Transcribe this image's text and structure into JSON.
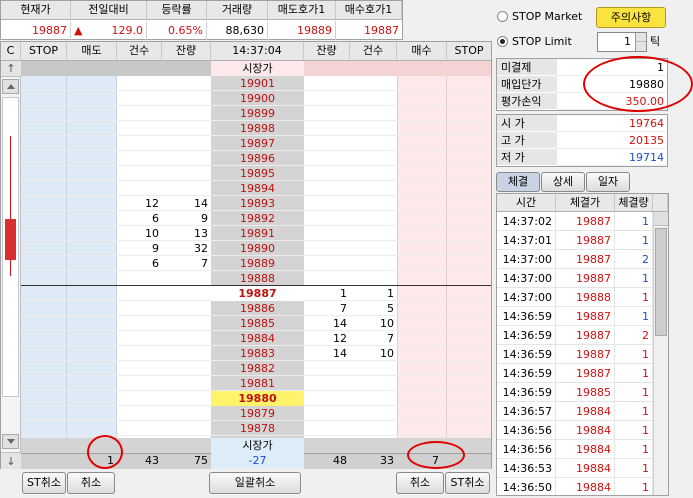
{
  "top_quote": {
    "headers": [
      "현재가",
      "전일대비",
      "등락률",
      "거래량",
      "매도호가1",
      "매수호가1"
    ],
    "current_price": "19887",
    "change_arrow": "▲",
    "change": "129.0",
    "change_rate": "0.65%",
    "volume": "88,630",
    "ask1": "19889",
    "bid1": "19887"
  },
  "orderbook_header": {
    "c": "C",
    "stop_left": "STOP",
    "sell": "매도",
    "sell_count": "건수",
    "sell_remain": "잔량",
    "time": "14:37:04",
    "buy_remain": "잔량",
    "buy_count": "건수",
    "buy": "매수",
    "stop_right": "STOP"
  },
  "market_price_label": "시장가",
  "price_rows": [
    {
      "price": "19901",
      "sell_count": "",
      "sell_remain": "",
      "buy_remain": "",
      "buy_count": ""
    },
    {
      "price": "19900",
      "sell_count": "",
      "sell_remain": "",
      "buy_remain": "",
      "buy_count": ""
    },
    {
      "price": "19899",
      "sell_count": "",
      "sell_remain": "",
      "buy_remain": "",
      "buy_count": ""
    },
    {
      "price": "19898",
      "sell_count": "",
      "sell_remain": "",
      "buy_remain": "",
      "buy_count": ""
    },
    {
      "price": "19897",
      "sell_count": "",
      "sell_remain": "",
      "buy_remain": "",
      "buy_count": ""
    },
    {
      "price": "19896",
      "sell_count": "",
      "sell_remain": "",
      "buy_remain": "",
      "buy_count": ""
    },
    {
      "price": "19895",
      "sell_count": "",
      "sell_remain": "",
      "buy_remain": "",
      "buy_count": ""
    },
    {
      "price": "19894",
      "sell_count": "",
      "sell_remain": "",
      "buy_remain": "",
      "buy_count": ""
    },
    {
      "price": "19893",
      "sell_count": "12",
      "sell_remain": "14",
      "buy_remain": "",
      "buy_count": ""
    },
    {
      "price": "19892",
      "sell_count": "6",
      "sell_remain": "9",
      "buy_remain": "",
      "buy_count": ""
    },
    {
      "price": "19891",
      "sell_count": "10",
      "sell_remain": "13",
      "buy_remain": "",
      "buy_count": ""
    },
    {
      "price": "19890",
      "sell_count": "9",
      "sell_remain": "32",
      "buy_remain": "",
      "buy_count": ""
    },
    {
      "price": "19889",
      "sell_count": "6",
      "sell_remain": "7",
      "buy_remain": "",
      "buy_count": ""
    },
    {
      "price": "19888",
      "sell_count": "",
      "sell_remain": "",
      "buy_remain": "",
      "buy_count": ""
    },
    {
      "price": "19887",
      "sell_count": "",
      "sell_remain": "",
      "buy_remain": "1",
      "buy_count": "1"
    },
    {
      "price": "19886",
      "sell_count": "",
      "sell_remain": "",
      "buy_remain": "7",
      "buy_count": "5"
    },
    {
      "price": "19885",
      "sell_count": "",
      "sell_remain": "",
      "buy_remain": "14",
      "buy_count": "10"
    },
    {
      "price": "19884",
      "sell_count": "",
      "sell_remain": "",
      "buy_remain": "12",
      "buy_count": "7"
    },
    {
      "price": "19883",
      "sell_count": "",
      "sell_remain": "",
      "buy_remain": "14",
      "buy_count": "10"
    },
    {
      "price": "19882",
      "sell_count": "",
      "sell_remain": "",
      "buy_remain": "",
      "buy_count": ""
    },
    {
      "price": "19881",
      "sell_count": "",
      "sell_remain": "",
      "buy_remain": "",
      "buy_count": ""
    },
    {
      "price": "19880",
      "sell_count": "",
      "sell_remain": "",
      "buy_remain": "",
      "buy_count": ""
    },
    {
      "price": "19879",
      "sell_count": "",
      "sell_remain": "",
      "buy_remain": "",
      "buy_count": ""
    },
    {
      "price": "19878",
      "sell_count": "",
      "sell_remain": "",
      "buy_remain": "",
      "buy_count": ""
    }
  ],
  "current_row_index": 14,
  "position_row_index": 21,
  "totals": {
    "sell_pending": "1",
    "sell_count": "43",
    "sell_remain": "75",
    "diff": "-27",
    "buy_remain": "48",
    "buy_count": "33",
    "buy_pending": "7"
  },
  "bottom_buttons": {
    "st_cancel_left": "ST취소",
    "cancel_left": "취소",
    "cancel_all": "일괄취소",
    "cancel_right": "취소",
    "st_cancel_right": "ST취소"
  },
  "right_panel": {
    "stop_market": "STOP Market",
    "stop_limit": "STOP Limit",
    "caution_button": "주의사항",
    "tick_value": "1",
    "tick_label": "틱",
    "position": [
      {
        "label": "미결제",
        "value": "1"
      },
      {
        "label": "매입단가",
        "value": "19880"
      },
      {
        "label": "평가손익",
        "value": "350.00"
      }
    ],
    "ohl": [
      {
        "label": "시 가",
        "value": "19764"
      },
      {
        "label": "고 가",
        "value": "20135"
      },
      {
        "label": "저 가",
        "value": "19714"
      }
    ],
    "tabs": [
      "체결",
      "상세",
      "일자"
    ],
    "trades_headers": [
      "시간",
      "체결가",
      "체결량"
    ],
    "trades": [
      {
        "time": "14:37:02",
        "price": "19887",
        "qty": "1",
        "side": "buy"
      },
      {
        "time": "14:37:01",
        "price": "19887",
        "qty": "1",
        "side": "buy"
      },
      {
        "time": "14:37:00",
        "price": "19887",
        "qty": "2",
        "side": "buy"
      },
      {
        "time": "14:37:00",
        "price": "19887",
        "qty": "1",
        "side": "buy"
      },
      {
        "time": "14:37:00",
        "price": "19888",
        "qty": "1",
        "side": "sell"
      },
      {
        "time": "14:36:59",
        "price": "19887",
        "qty": "1",
        "side": "buy"
      },
      {
        "time": "14:36:59",
        "price": "19887",
        "qty": "2",
        "side": "sell"
      },
      {
        "time": "14:36:59",
        "price": "19887",
        "qty": "1",
        "side": "sell"
      },
      {
        "time": "14:36:59",
        "price": "19887",
        "qty": "1",
        "side": "sell"
      },
      {
        "time": "14:36:59",
        "price": "19885",
        "qty": "1",
        "side": "sell"
      },
      {
        "time": "14:36:57",
        "price": "19884",
        "qty": "1",
        "side": "sell"
      },
      {
        "time": "14:36:56",
        "price": "19884",
        "qty": "1",
        "side": "sell"
      },
      {
        "time": "14:36:56",
        "price": "19884",
        "qty": "1",
        "side": "sell"
      },
      {
        "time": "14:36:53",
        "price": "19884",
        "qty": "1",
        "side": "sell"
      },
      {
        "time": "14:36:50",
        "price": "19884",
        "qty": "1",
        "side": "sell"
      }
    ]
  },
  "scroll": {
    "up_arrow": "↑",
    "down_arrow": "↓"
  },
  "colors": {
    "sell_bg": "#deebf7",
    "buy_bg": "#fde9e9",
    "price_bg": "#d4d4d4",
    "current_price_bg": "#ffffff",
    "position_price_bg": "#fff36b",
    "up_color": "#d01010",
    "down_color": "#1a4fd0",
    "caution_bg": "#fbe340"
  }
}
